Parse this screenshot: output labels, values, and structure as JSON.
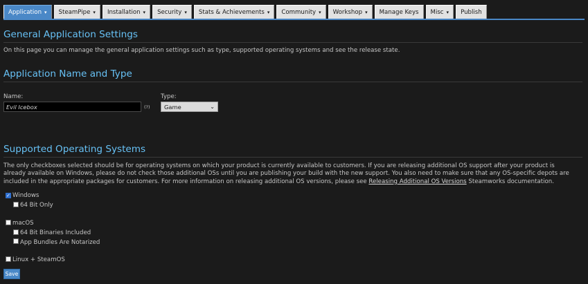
{
  "nav": {
    "tabs": [
      {
        "label": "Application",
        "dropdown": true,
        "active": true
      },
      {
        "label": "SteamPipe",
        "dropdown": true
      },
      {
        "label": "Installation",
        "dropdown": true
      },
      {
        "label": "Security",
        "dropdown": true
      },
      {
        "label": "Stats & Achievements",
        "dropdown": true
      },
      {
        "label": "Community",
        "dropdown": true
      },
      {
        "label": "Workshop",
        "dropdown": true
      },
      {
        "label": "Manage Keys",
        "dropdown": false
      },
      {
        "label": "Misc",
        "dropdown": true
      },
      {
        "label": "Publish",
        "dropdown": false
      }
    ],
    "caret": "▾"
  },
  "general": {
    "title": "General Application Settings",
    "description": "On this page you can manage the general application settings such as type, supported operating systems and see the release state."
  },
  "name_type": {
    "title": "Application Name and Type",
    "name_label": "Name:",
    "name_value": "Evil Icebox",
    "help_marker": "(?)",
    "type_label": "Type:",
    "type_value": "Game"
  },
  "os": {
    "title": "Supported Operating Systems",
    "para_before_link": "The only checkboxes selected should be for operating systems on which your product is currently available to customers. If you are releasing additional OS support after your product is already available on Windows, please do not check those additional OSs until you are publishing your build with the new support. You also need to make sure that any OS-specific depots are included in the appropriate packages for customers. For more information on releasing additional OS versions, please see ",
    "link_text": "Releasing Additional OS Versions",
    "para_after_link": " Steamworks documentation.",
    "windows": {
      "label": "Windows",
      "checked": true
    },
    "windows_64": {
      "label": "64 Bit Only",
      "checked": false
    },
    "macos": {
      "label": "macOS",
      "checked": false
    },
    "macos_64": {
      "label": "64 Bit Binaries Included",
      "checked": false
    },
    "macos_notarized": {
      "label": "App Bundles Are Notarized",
      "checked": false
    },
    "linux": {
      "label": "Linux + SteamOS",
      "checked": false
    }
  },
  "save_label": "Save",
  "colors": {
    "accent": "#4a88c7",
    "heading": "#67c1f5",
    "background": "#1b1b1b"
  }
}
